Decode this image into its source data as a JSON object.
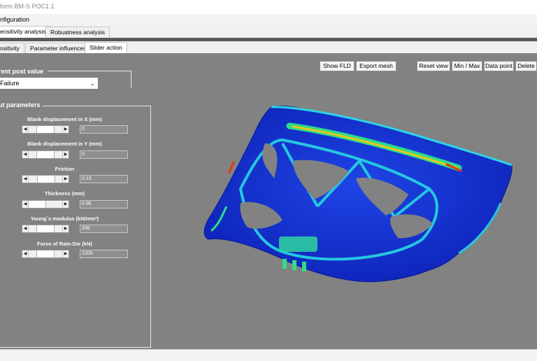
{
  "window": {
    "title": "form BM-S POC1.1"
  },
  "menu": {
    "configuration": "nfiguration"
  },
  "top_tabs": [
    {
      "label": "ensitivity analysis",
      "active": true
    },
    {
      "label": "Robustness analysis",
      "active": false
    }
  ],
  "sub_tabs": [
    {
      "label": "nsitivity",
      "active": false
    },
    {
      "label": "Parameter influences",
      "active": false
    },
    {
      "label": "Slider action",
      "active": true
    }
  ],
  "toolbar": {
    "show_fld": "Show FLD",
    "export_mesh": "Export mesh",
    "reset_view": "Reset view",
    "min_max": "Min / Max",
    "data_point": "Data point",
    "delete": "Delete"
  },
  "post_value": {
    "legend": "rent post value",
    "selected": "Failure"
  },
  "input_params": {
    "legend": "ut parameters",
    "items": [
      {
        "label": "Blank displacement in X (mm)",
        "value": "0",
        "level": 0.5
      },
      {
        "label": "Blank displacement in Y (mm)",
        "value": "0",
        "level": 0.5
      },
      {
        "label": "Friction",
        "value": "0.13",
        "level": 0.55
      },
      {
        "label": "Thickness (mm)",
        "value": "0.96",
        "level": 0.0
      },
      {
        "label": "Young´s modulus (kN/mm²)",
        "value": "206",
        "level": 0.5
      },
      {
        "label": "Force of Ram-Die (kN)",
        "value": "1200",
        "level": 0.5
      }
    ]
  },
  "colors": {
    "viewport": "#828282",
    "mesh_base": "#1a36d6",
    "mesh_mid": "#25c7e0",
    "mesh_high": "#e43515"
  }
}
